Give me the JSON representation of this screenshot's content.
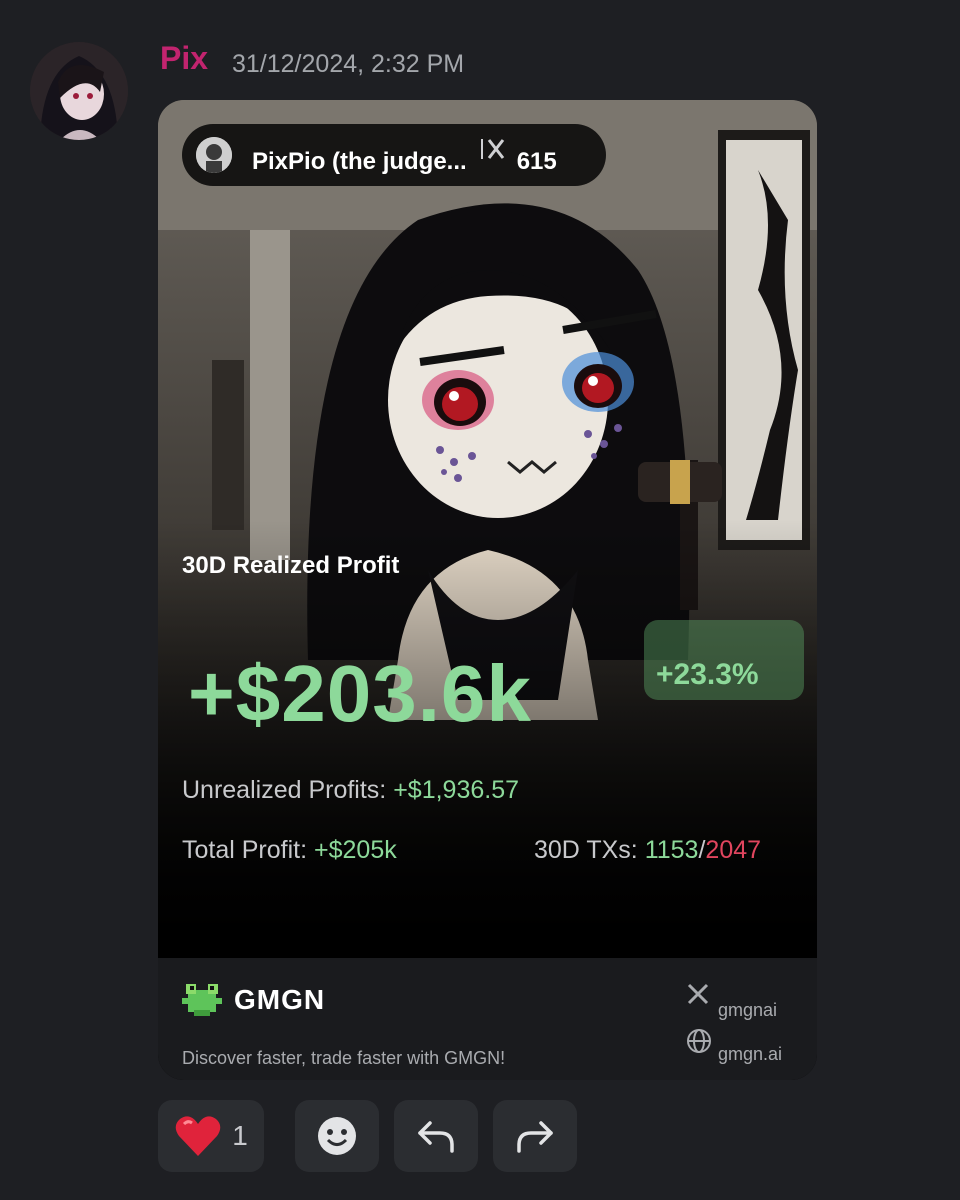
{
  "message": {
    "author": "Pix",
    "timestamp": "31/12/2024, 2:32 PM",
    "avatar_icon": "avatar"
  },
  "card": {
    "profile": {
      "name": "PixPio (the judge...",
      "followers": "615",
      "x_icon": "x-icon"
    },
    "realized_label": "30D Realized Profit",
    "realized_value": "+$203.6k",
    "realized_pct": "+23.3%",
    "unrealized_label": "Unrealized Profits:",
    "unrealized_value": "+$1,936.57",
    "total_label": "Total Profit:",
    "total_value": "+$205k",
    "txs_label": "30D TXs:",
    "txs_buys": "1153",
    "txs_sep": "/",
    "txs_sells": "2047",
    "footer": {
      "brand": "GMGN",
      "tagline": "Discover faster, trade faster with GMGN!",
      "x_handle": "gmgnai",
      "site": "gmgn.ai"
    },
    "colors": {
      "profit_green": "#8dd99a",
      "sell_red": "#e0455e",
      "author_pink": "#c2246f"
    }
  },
  "reactions": {
    "heart_count": "1",
    "heart_icon": "heart-icon",
    "emoji_icon": "add-reaction-icon",
    "reply_icon": "reply-icon",
    "forward_icon": "forward-icon"
  }
}
